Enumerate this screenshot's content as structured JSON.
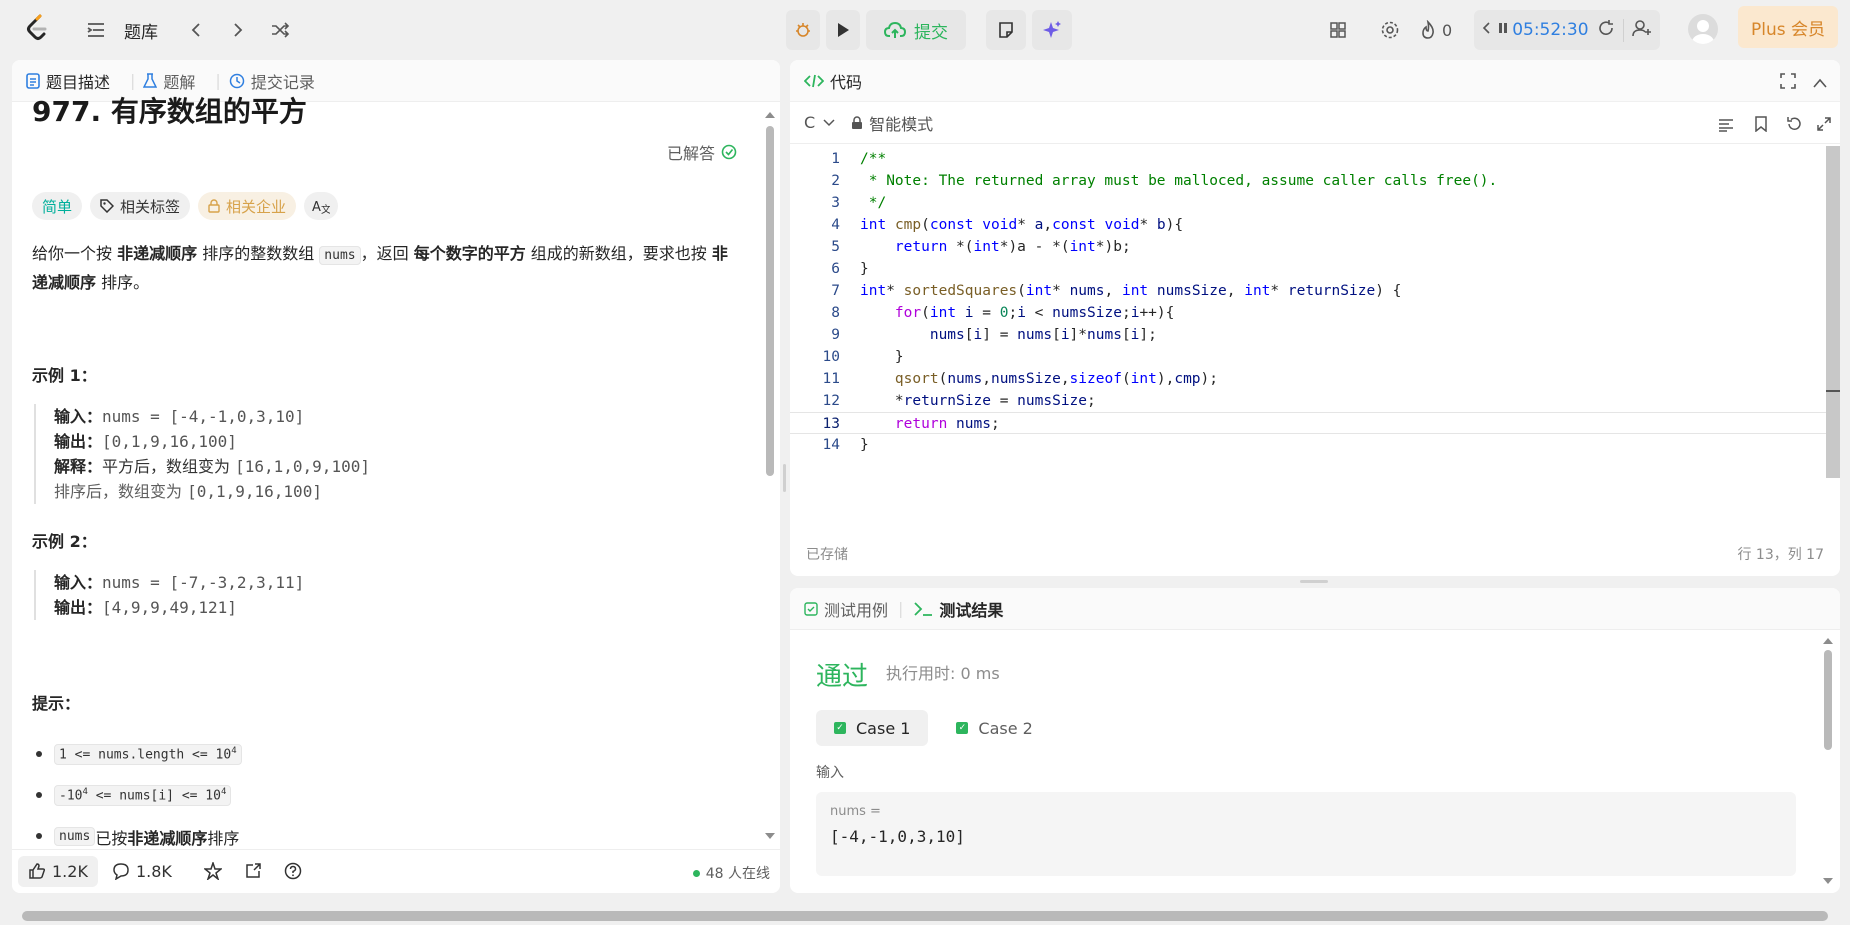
{
  "topbar": {
    "problem_list_label": "题库",
    "submit_label": "提交",
    "streak_count": "0",
    "timer": "05:52:30",
    "plus_label": "Plus 会员"
  },
  "left": {
    "tabs": [
      {
        "label": "题目描述"
      },
      {
        "label": "题解"
      },
      {
        "label": "提交记录"
      }
    ],
    "title": "977. 有序数组的平方",
    "solved_label": "已解答",
    "badges": {
      "difficulty": "简单",
      "tags": "相关标签",
      "companies": "相关企业",
      "font": "Ꭿ"
    },
    "description": {
      "p1": "给你一个按 ",
      "b1": "非递减顺序",
      "p2": " 排序的整数数组 ",
      "code1": "nums",
      "p3": "，返回 ",
      "b2": "每个数字的平方",
      "p4": " 组成的新数组，要求也按 ",
      "b3": "非递减顺序",
      "p5": " 排序。"
    },
    "example1": {
      "title": "示例 1：",
      "input_label": "输入：",
      "input": "nums = [-4,-1,0,3,10]",
      "output_label": "输出：",
      "output": "[0,1,9,16,100]",
      "explain_label": "解释：",
      "explain1_text": "平方后，数组变为 ",
      "explain1_code": "[16,1,0,9,100]",
      "explain2_text": "排序后，数组变为 ",
      "explain2_code": "[0,1,9,16,100]"
    },
    "example2": {
      "title": "示例 2：",
      "input_label": "输入：",
      "input": "nums = [-7,-3,2,3,11]",
      "output_label": "输出：",
      "output": "[4,9,9,49,121]"
    },
    "hints": {
      "title": "提示：",
      "h1_code": "1 <= nums.length <= 10",
      "h1_sup": "4",
      "h2_pre": "-10",
      "h2_sup1": "4",
      "h2_mid": " <= nums[i] <= 10",
      "h2_sup2": "4",
      "h3_code": "nums",
      "h3_text1": " 已按 ",
      "h3_bold": "非递减顺序",
      "h3_text2": " 排序"
    },
    "footer": {
      "likes": "1.2K",
      "comments": "1.8K",
      "online": "48 人在线"
    }
  },
  "code": {
    "header": "代码",
    "language": "C",
    "mode": "智能模式",
    "saved": "已存储",
    "cursor": "行 13，列 17",
    "line_numbers": [
      "1",
      "2",
      "3",
      "4",
      "5",
      "6",
      "7",
      "8",
      "9",
      "10",
      "11",
      "12",
      "13",
      "14"
    ]
  },
  "test": {
    "tabs": [
      {
        "label": "测试用例"
      },
      {
        "label": "测试结果"
      }
    ],
    "status": "通过",
    "runtime": "执行用时: 0 ms",
    "cases": [
      {
        "label": "Case 1"
      },
      {
        "label": "Case 2"
      }
    ],
    "input_label": "输入",
    "input_name": "nums =",
    "input_value": "[-4,-1,0,3,10]"
  },
  "colors": {
    "accent_green": "#2db55d",
    "timer_blue": "#2f7fe0",
    "plus_orange": "#d7862a",
    "easy_teal": "#00af9b"
  }
}
